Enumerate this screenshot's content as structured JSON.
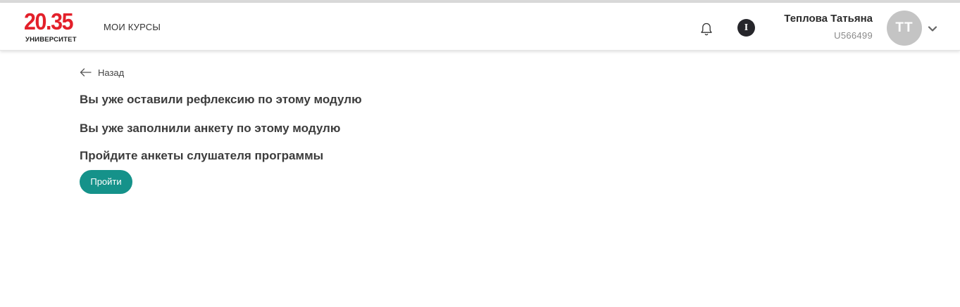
{
  "header": {
    "logo": {
      "number": "20.35",
      "subtitle": "УНИВЕРСИТЕТ",
      "color": "#e3202a"
    },
    "nav": {
      "my_courses": "МОИ КУРСЫ"
    },
    "info_icon": "I",
    "user": {
      "name": "Теплова Татьяна",
      "id": "U566499",
      "initials": "ТТ"
    }
  },
  "main": {
    "back_label": "Назад",
    "messages": [
      "Вы уже оставили рефлексию по этому модулю",
      "Вы уже заполнили анкету по этому модулю",
      "Пройдите анкеты слушателя программы"
    ],
    "action_button": "Пройти"
  },
  "colors": {
    "accent": "#15928a",
    "brand": "#e3202a"
  },
  "icons": [
    "bell-icon",
    "info-icon",
    "chevron-down-icon",
    "arrow-left-icon"
  ]
}
